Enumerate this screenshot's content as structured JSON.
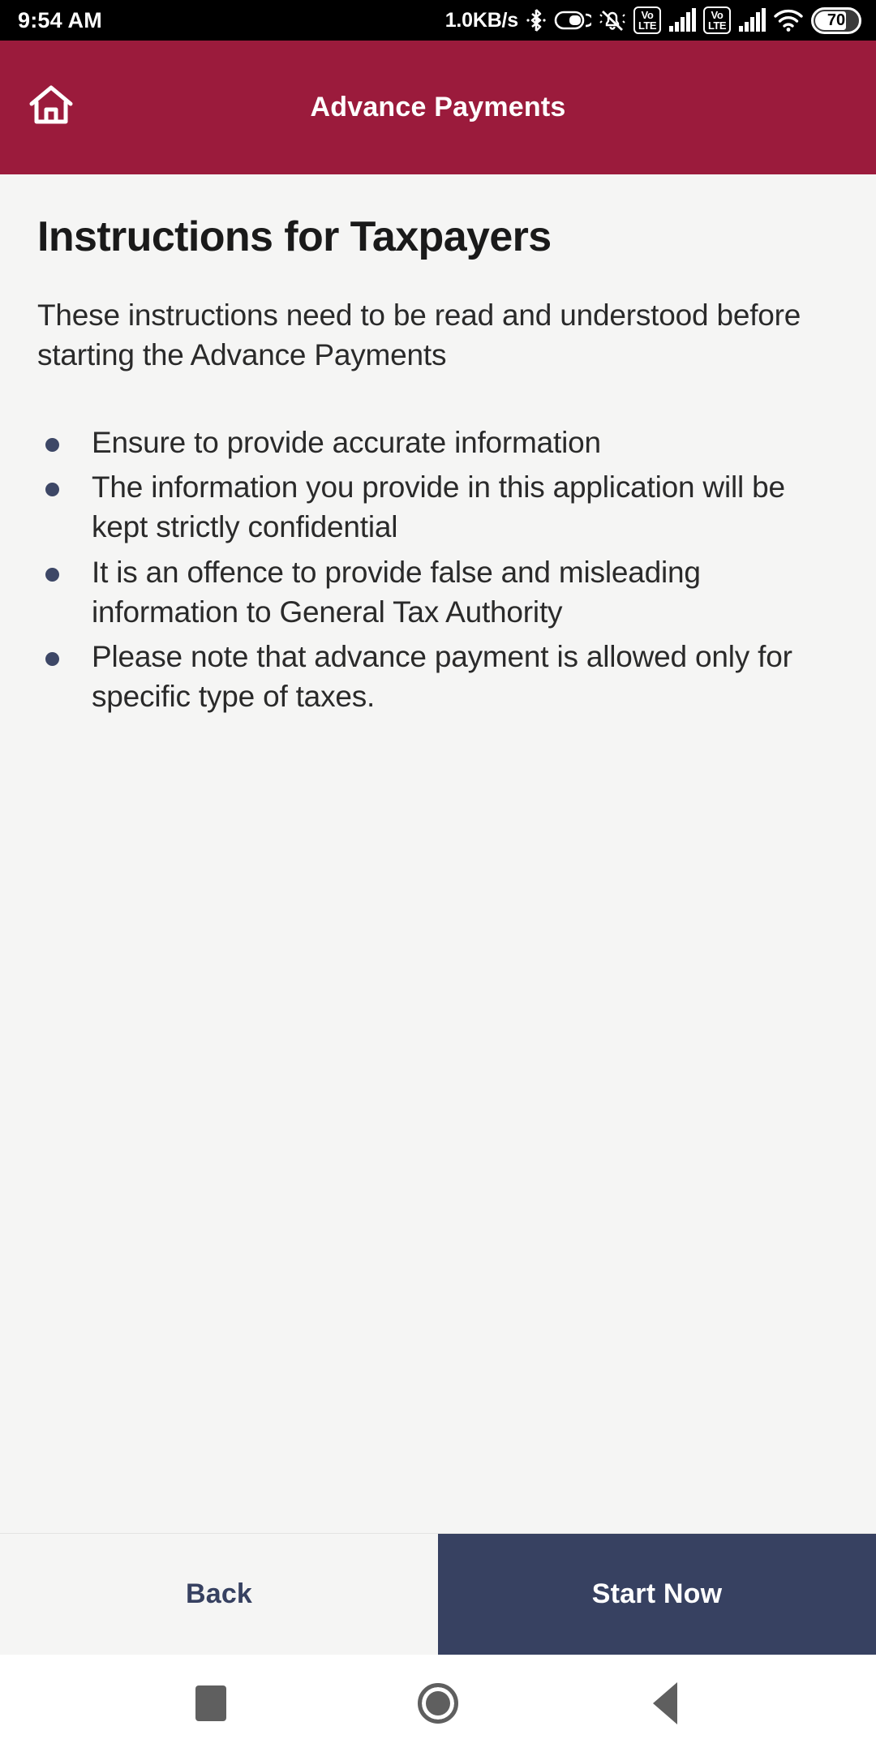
{
  "status_bar": {
    "clock": "9:54 AM",
    "network_speed": "1.0KB/s",
    "icons": [
      "bluetooth-icon",
      "vibrate-toggle-icon",
      "mute-bell-icon",
      "volte-icon",
      "signal-bars-icon",
      "volte-icon",
      "signal-bars-icon",
      "wifi-icon"
    ],
    "volte_top": "Vo",
    "volte_bottom": "LTE",
    "battery_level": "70"
  },
  "app_bar": {
    "home_icon": "home-icon",
    "title": "Advance Payments",
    "background_color": "#9B1B3C"
  },
  "content": {
    "page_title": "Instructions for Taxpayers",
    "intro": "These instructions need to be read and understood before starting the Advance Payments",
    "bullets": [
      "Ensure to provide accurate information",
      "The information you provide in this application will be kept strictly confidential",
      "It is an offence to provide false and misleading information to General Tax Authority",
      "Please note that advance payment is allowed only for specific type of taxes."
    ],
    "bullet_color": "#3D4766",
    "background_color": "#F5F5F4"
  },
  "actions": {
    "back_label": "Back",
    "start_label": "Start Now",
    "primary_color": "#374161"
  },
  "nav_bar": {
    "recents": "square-recents-icon",
    "home": "circle-home-icon",
    "back": "triangle-back-icon"
  }
}
